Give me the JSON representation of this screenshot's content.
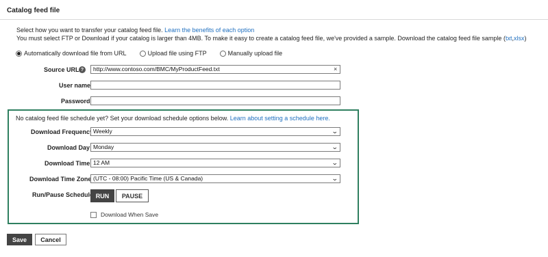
{
  "header": {
    "title": "Catalog feed file"
  },
  "description": {
    "line1_text": "Select how you want to transfer your catalog feed file.",
    "line1_link": "Learn the benefits of each option",
    "line2_text": "You must select FTP or Download if your catalog is larger than 4MB. To make it easy to create a catalog feed file, we've provided a sample. Download the catalog feed file sample",
    "line2_paren_open": "(",
    "line2_link_txt": "txt",
    "line2_comma": ",",
    "line2_link_xlsx": "xlsx",
    "line2_paren_close": ")"
  },
  "transfer_options": [
    {
      "label": "Automatically download file from URL",
      "selected": true
    },
    {
      "label": "Upload file using FTP",
      "selected": false
    },
    {
      "label": "Manually upload file",
      "selected": false
    }
  ],
  "fields": {
    "source_url": {
      "label": "Source URL",
      "value": "http://www.contoso.com/BMC/MyProductFeed.txt",
      "help_icon": "question-circle-icon",
      "clear_icon": "close-icon"
    },
    "user_name": {
      "label": "User name",
      "value": ""
    },
    "password": {
      "label": "Password",
      "value": ""
    }
  },
  "schedule": {
    "note_text": "No catalog feed file schedule yet? Set your download schedule options below.",
    "note_link": "Learn about setting a schedule here.",
    "frequency": {
      "label": "Download Frequency",
      "value": "Weekly"
    },
    "day": {
      "label": "Download Day",
      "value": "Monday"
    },
    "time": {
      "label": "Download Time",
      "value": "12 AM"
    },
    "timezone": {
      "label": "Download Time Zone",
      "value": "(UTC - 08:00) Pacific Time (US & Canada)"
    },
    "run_pause": {
      "label": "Run/Pause Schedule",
      "run_label": "RUN",
      "pause_label": "PAUSE",
      "active": "RUN"
    },
    "download_when_save": {
      "label": "Download When Save",
      "checked": false
    },
    "border_color": "#2e7f5f"
  },
  "actions": {
    "save_label": "Save",
    "cancel_label": "Cancel"
  },
  "colors": {
    "link": "#1f6fbf",
    "primary_button": "#444444"
  }
}
